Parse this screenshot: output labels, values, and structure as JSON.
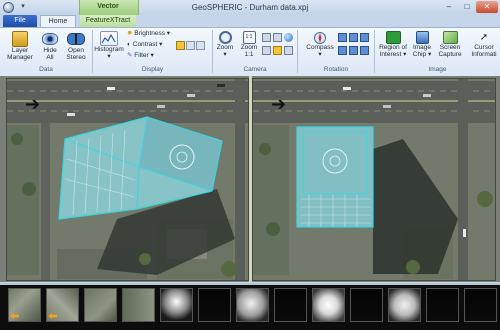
{
  "window": {
    "title": "GeoSPHERIC - Durham data.xpj",
    "qat_glyph": "▾",
    "controls": {
      "minimize": "–",
      "maximize": "□",
      "close": "✕"
    }
  },
  "contextual_tab_group": "Vector",
  "tabs": [
    {
      "label": "File",
      "active": false
    },
    {
      "label": "Home",
      "active": true
    },
    {
      "label": "FeatureXTract",
      "active": false
    }
  ],
  "ribbon": {
    "groups": [
      {
        "label": "Data",
        "buttons": [
          "Layer Manager",
          "Hide All",
          "Open Stereo"
        ]
      },
      {
        "label": "Display",
        "buttons": [
          "Histogram ▾"
        ],
        "small": [
          "Brightness ▾",
          "Contrast ▾",
          "Filter ▾"
        ]
      },
      {
        "label": "Camera",
        "buttons": [
          "Zoom ▾",
          "Zoom 1:1"
        ]
      },
      {
        "label": "Rotation",
        "buttons": [
          "Compass ▾"
        ]
      },
      {
        "label": "Image",
        "buttons": [
          "Region of Interest ▾",
          "Image Chip ▾",
          "Screen Capture",
          "Cursor Information"
        ]
      }
    ],
    "labels": {
      "layer_manager": [
        "Layer",
        "Manager"
      ],
      "hide_all": [
        "Hide",
        "All"
      ],
      "open_stereo": [
        "Open",
        "Stereo"
      ],
      "histogram": [
        "Histogram",
        "▾"
      ],
      "brightness": "Brightness ▾",
      "contrast": "Contrast ▾",
      "filter": "Filter ▾",
      "zoom": [
        "Zoom",
        "▾"
      ],
      "zoom11": [
        "Zoom",
        "1:1"
      ],
      "compass": [
        "Compass",
        "▾"
      ],
      "roi": [
        "Region of",
        "Interest ▾"
      ],
      "chip": [
        "Image",
        "Chip ▾"
      ],
      "capture": [
        "Screen",
        "Capture"
      ],
      "cursor": [
        "Cursor",
        "Informati"
      ]
    },
    "group_labels": {
      "data": "Data",
      "display": "Display",
      "camera": "Camera",
      "rotation": "Rotation",
      "image": "Image"
    }
  },
  "viewer": {
    "panes": [
      "left-mono-view",
      "right-stereo-view"
    ],
    "direction_arrow": "➔"
  },
  "colors": {
    "accent_file": "#1e4ea8",
    "vector_overlay": "#3ad6e0",
    "contextual": "#9ccd7c"
  },
  "thumbnails": {
    "count": 13
  }
}
